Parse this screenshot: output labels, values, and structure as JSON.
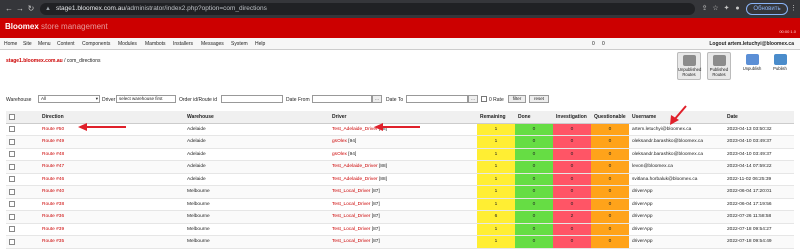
{
  "browser": {
    "url_host": "stage1.bloomex.com.au",
    "url_path": "/administrator/index2.php?option=com_directions",
    "refresh_label": "Обновить"
  },
  "header": {
    "logo": "Bloomex",
    "logo_sub": " store management",
    "version": "00:00 1.0"
  },
  "menu": {
    "items": [
      "Home",
      "Site",
      "Menu",
      "Content",
      "Components",
      "Modules",
      "Mambots",
      "Installers",
      "Messages",
      "System",
      "Help"
    ],
    "count_a": "0",
    "count_b": "0",
    "logout": "Logout artem.letuchyi@bloomex.ca"
  },
  "breadcrumb": {
    "site": "stage1.bloomex.com.au",
    "rest": " / com_directions"
  },
  "toolbar": {
    "buttons": [
      "Unpublished Routes",
      "Published Routes",
      "Unpublish",
      "Publish"
    ]
  },
  "filters": {
    "warehouse_label": "Warehouse",
    "warehouse_value": "All",
    "driver_label": "Driver",
    "driver_value": "select warehouse first",
    "order_label": "Order id/Route id",
    "date_from_label": "Date From",
    "date_to_label": "Date To",
    "dots": "...",
    "rate_label": "0 Rate",
    "filter_btn": "filter",
    "reset_btn": "reset"
  },
  "table": {
    "headers": [
      "Direction",
      "Warehouse",
      "Driver",
      "Remaining",
      "Done",
      "Investigation",
      "Questionable",
      "Username",
      "Date"
    ],
    "rows": [
      {
        "direction": "Route #50",
        "warehouse": "Adelaide",
        "driver": "Test_Adelaide_Driver",
        "driver_id": "[88]",
        "remaining": "1",
        "done": "0",
        "investigation": "0",
        "questionable": "0",
        "username": "artem.letuchyi@bloomex.ca",
        "date": "2023-04-13 03:50:32"
      },
      {
        "direction": "Route #49",
        "warehouse": "Adelaide",
        "driver": "gsOlex",
        "driver_id": "[94]",
        "remaining": "1",
        "done": "0",
        "investigation": "0",
        "questionable": "0",
        "username": "oleksandr.barashko@bloomex.ca",
        "date": "2023-04-10 03:49:37"
      },
      {
        "direction": "Route #48",
        "warehouse": "Adelaide",
        "driver": "gsOlex",
        "driver_id": "[94]",
        "remaining": "1",
        "done": "0",
        "investigation": "0",
        "questionable": "0",
        "username": "oleksandr.barashko@bloomex.ca",
        "date": "2023-04-10 03:49:37"
      },
      {
        "direction": "Route #47",
        "warehouse": "Adelaide",
        "driver": "Test_Adelaide_Driver",
        "driver_id": "[88]",
        "remaining": "1",
        "done": "0",
        "investigation": "0",
        "questionable": "0",
        "username": "levon@bloomex.ca",
        "date": "2023-04-14 07:59:22"
      },
      {
        "direction": "Route #46",
        "warehouse": "Adelaide",
        "driver": "Test_Adelaide_Driver",
        "driver_id": "[88]",
        "remaining": "1",
        "done": "0",
        "investigation": "0",
        "questionable": "0",
        "username": "svitlana.horbaluk@bloomex.ca",
        "date": "2022-11-02 06:25:39"
      },
      {
        "direction": "Route #40",
        "warehouse": "Melbourne",
        "driver": "Test_Local_Driver",
        "driver_id": "[87]",
        "remaining": "1",
        "done": "0",
        "investigation": "0",
        "questionable": "0",
        "username": "driverApp",
        "date": "2022-06-04 17:20:01"
      },
      {
        "direction": "Route #38",
        "warehouse": "Melbourne",
        "driver": "Test_Local_Driver",
        "driver_id": "[87]",
        "remaining": "1",
        "done": "0",
        "investigation": "0",
        "questionable": "0",
        "username": "driverApp",
        "date": "2022-06-04 17:19:56"
      },
      {
        "direction": "Route #36",
        "warehouse": "Melbourne",
        "driver": "Test_Local_Driver",
        "driver_id": "[87]",
        "remaining": "6",
        "done": "0",
        "investigation": "2",
        "questionable": "0",
        "username": "driverApp",
        "date": "2022-07-26 11:58:58"
      },
      {
        "direction": "Route #39",
        "warehouse": "Melbourne",
        "driver": "Test_Local_Driver",
        "driver_id": "[87]",
        "remaining": "1",
        "done": "0",
        "investigation": "0",
        "questionable": "0",
        "username": "driverApp",
        "date": "2022-07-18 09:54:27"
      },
      {
        "direction": "Route #35",
        "warehouse": "Melbourne",
        "driver": "Test_Local_Driver",
        "driver_id": "[87]",
        "remaining": "1",
        "done": "0",
        "investigation": "0",
        "questionable": "0",
        "username": "driverApp",
        "date": "2022-07-18 09:54:49"
      }
    ]
  },
  "colors": {
    "brand": "#cc0000",
    "remaining": "#ffee33",
    "done": "#66dd44",
    "investigation": "#ff5566",
    "questionable": "#ffa31a",
    "arrow": "#e0202a"
  }
}
